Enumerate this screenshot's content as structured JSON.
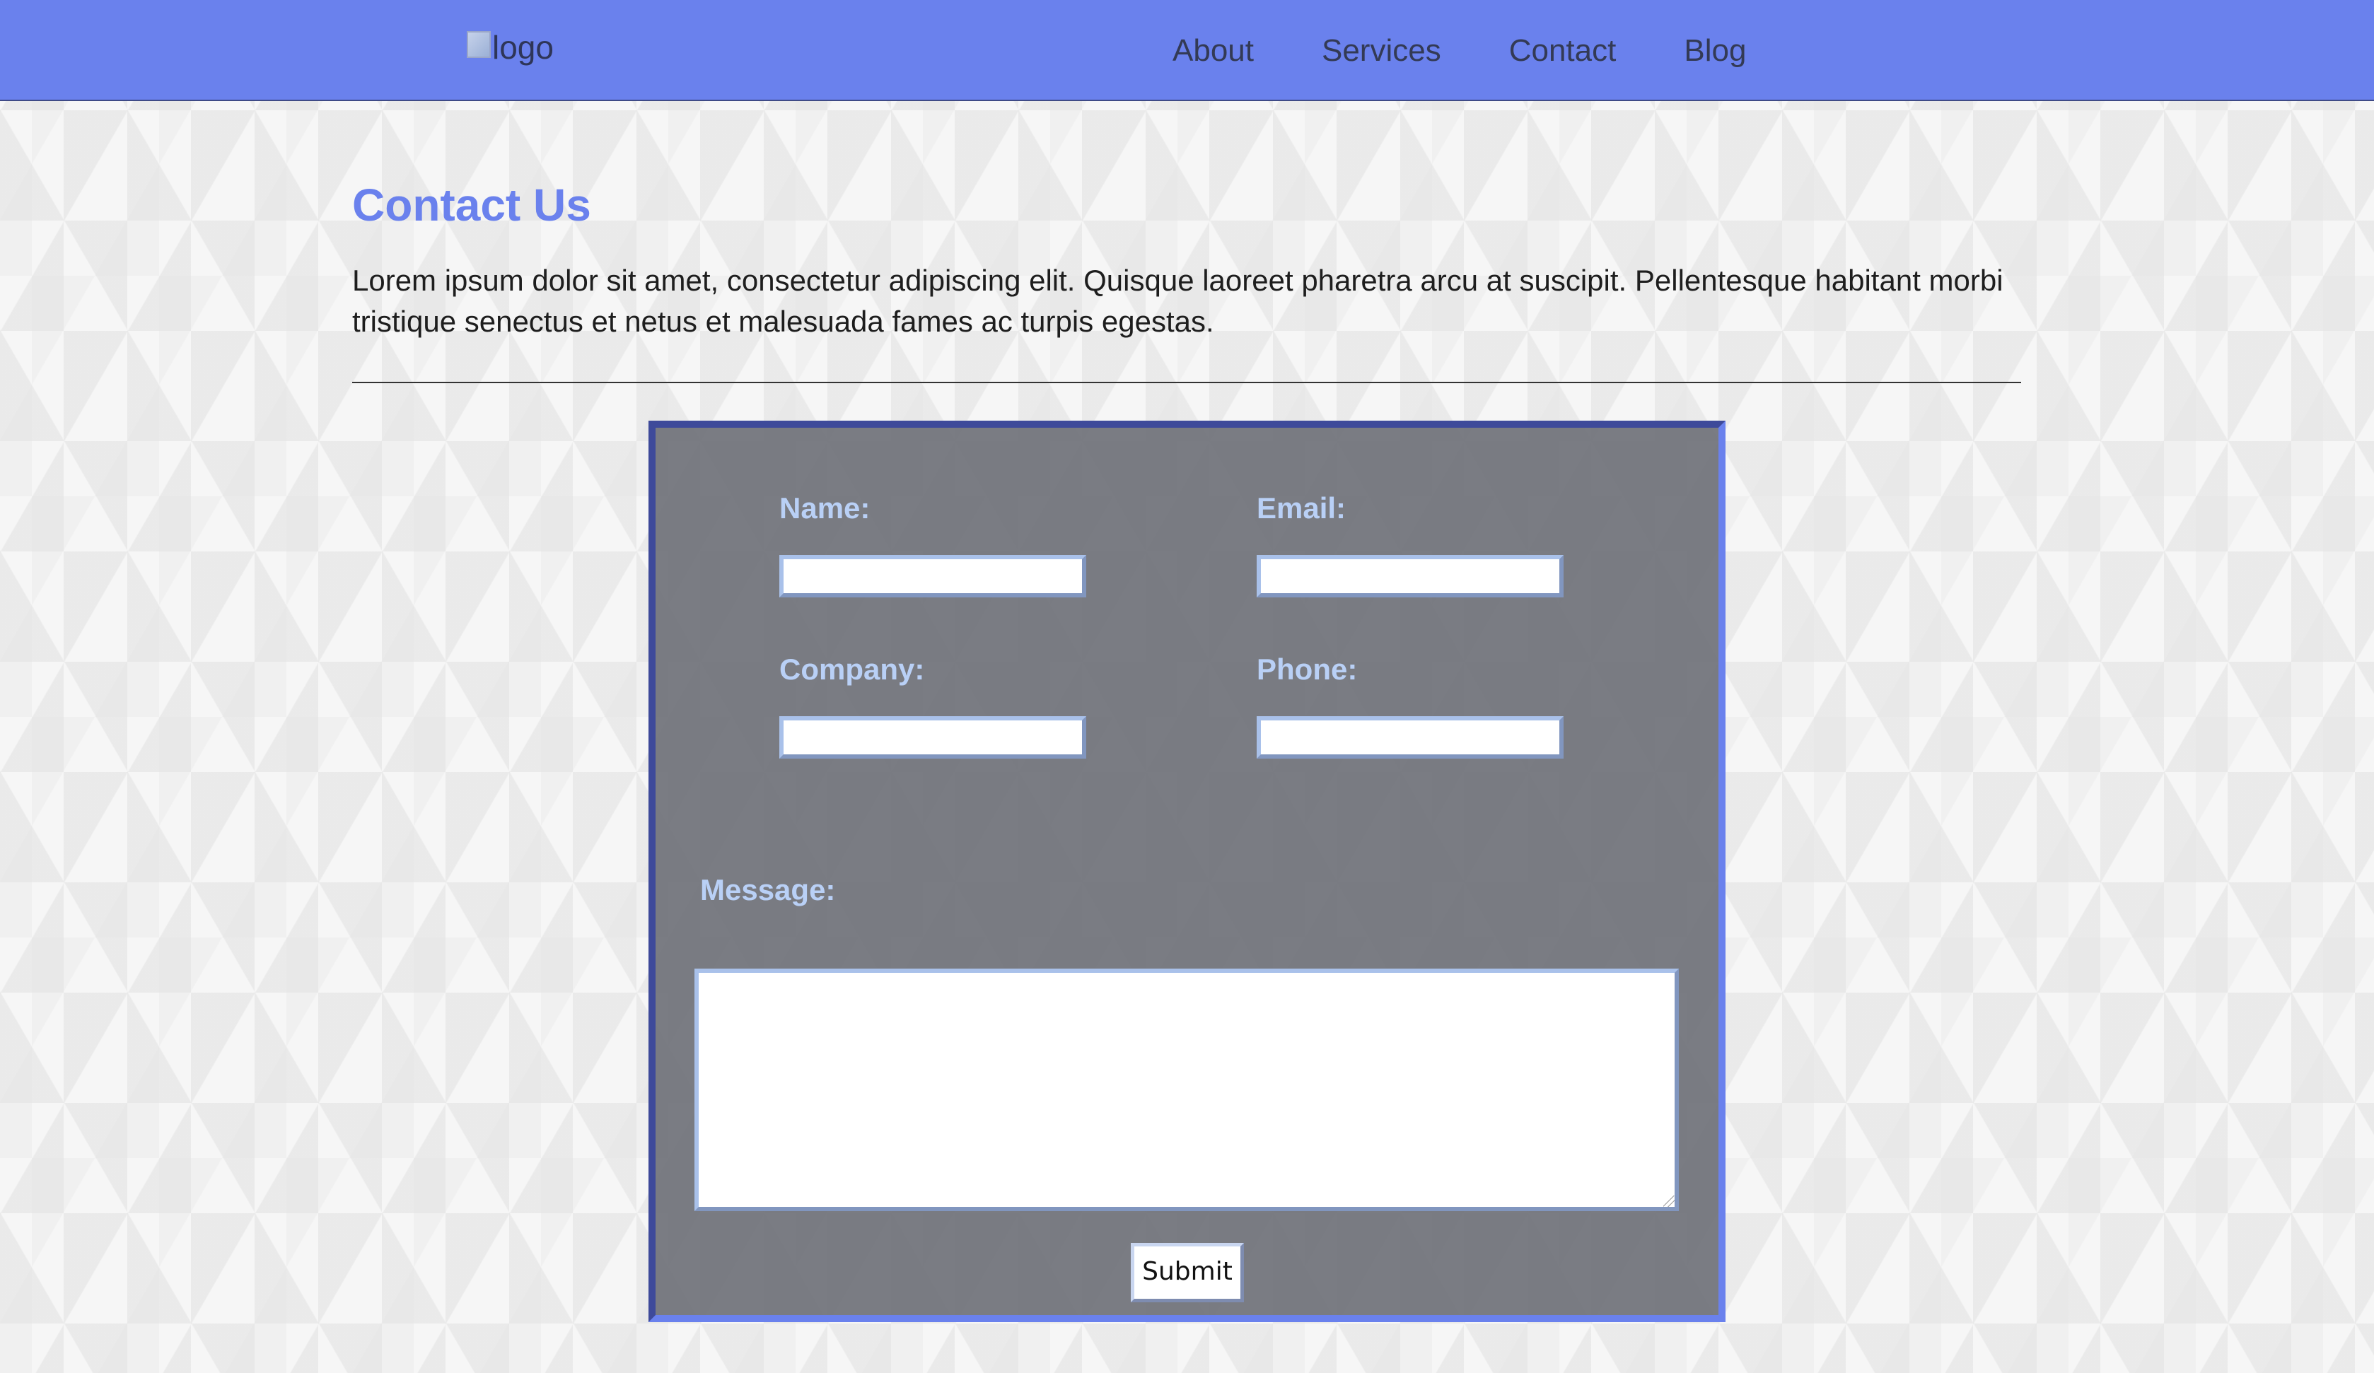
{
  "header": {
    "logo_alt": "logo",
    "nav": [
      {
        "label": "About"
      },
      {
        "label": "Services"
      },
      {
        "label": "Contact"
      },
      {
        "label": "Blog"
      }
    ]
  },
  "main": {
    "title": "Contact Us",
    "intro": "Lorem ipsum dolor sit amet, consectetur adipiscing elit. Quisque laoreet pharetra arcu at suscipit. Pellentesque habitant morbi tristique senectus et netus et malesuada fames ac turpis egestas."
  },
  "form": {
    "name_label": "Name:",
    "name_value": "",
    "email_label": "Email:",
    "email_value": "",
    "company_label": "Company:",
    "company_value": "",
    "phone_label": "Phone:",
    "phone_value": "",
    "message_label": "Message:",
    "message_value": "",
    "submit_label": "Submit"
  },
  "colors": {
    "header_bg": "#6a81ed",
    "accent": "#6a81ed",
    "form_bg": "#707280",
    "label": "#b9d0f6"
  }
}
